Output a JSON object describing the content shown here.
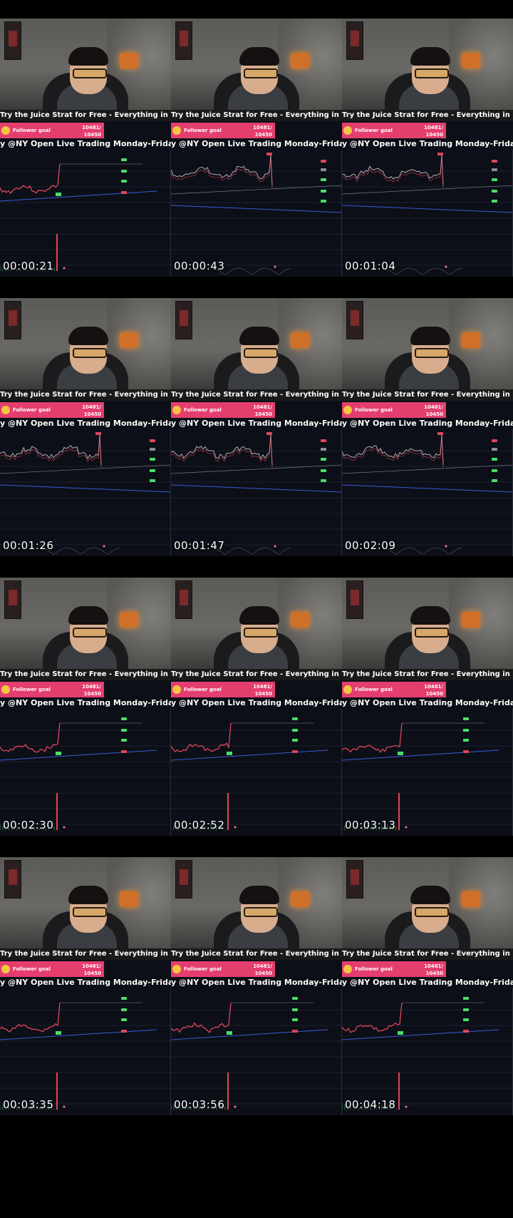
{
  "frames": [
    {
      "timestamp": "00:00:21",
      "chart_style": "A"
    },
    {
      "timestamp": "00:00:43",
      "chart_style": "B"
    },
    {
      "timestamp": "00:01:04",
      "chart_style": "B"
    },
    {
      "timestamp": "00:01:26",
      "chart_style": "B"
    },
    {
      "timestamp": "00:01:47",
      "chart_style": "B"
    },
    {
      "timestamp": "00:02:09",
      "chart_style": "B"
    },
    {
      "timestamp": "00:02:30",
      "chart_style": "A"
    },
    {
      "timestamp": "00:02:52",
      "chart_style": "A"
    },
    {
      "timestamp": "00:03:13",
      "chart_style": "A"
    },
    {
      "timestamp": "00:03:35",
      "chart_style": "A"
    },
    {
      "timestamp": "00:03:56",
      "chart_style": "A"
    },
    {
      "timestamp": "00:04:18",
      "chart_style": "A"
    }
  ],
  "overlay": {
    "banner_text": "Try the Juice Strat for Free - Everything in my",
    "goal_label": "Follower goal",
    "goal_current": "10481/",
    "goal_target": "10450",
    "subtitle_text": "y @NY Open   Live Trading Monday-Frida"
  },
  "colors": {
    "chart_bg": "#0c0f17",
    "goal_pink": "#e43e6e",
    "bull_green": "#4ade6a",
    "bear_red": "#e0455a",
    "trend_blue": "#3a5bd8"
  }
}
